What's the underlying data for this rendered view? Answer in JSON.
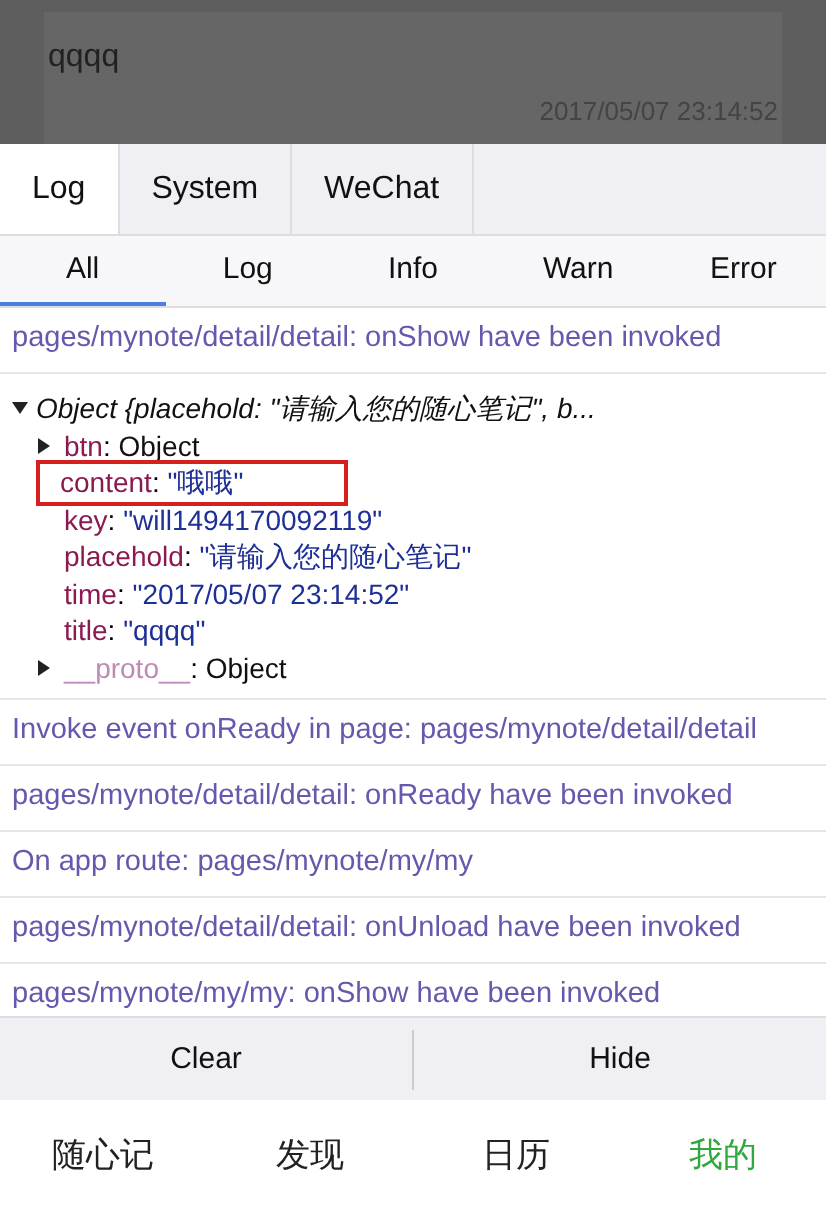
{
  "note_card": {
    "title": "qqqq",
    "time": "2017/05/07 23:14:52"
  },
  "tabs": [
    {
      "label": "Log",
      "selected": true
    },
    {
      "label": "System",
      "selected": false
    },
    {
      "label": "WeChat",
      "selected": false
    }
  ],
  "filters": [
    {
      "label": "All",
      "selected": true
    },
    {
      "label": "Log",
      "selected": false
    },
    {
      "label": "Info",
      "selected": false
    },
    {
      "label": "Warn",
      "selected": false
    },
    {
      "label": "Error",
      "selected": false
    }
  ],
  "log_entries": [
    {
      "kind": "text",
      "text": "pages/mynote/detail/detail: onShow have been invoked"
    },
    {
      "kind": "object",
      "summary": "Object {placehold: \"请输入您的随心笔记\", b...",
      "expanded": true,
      "properties": [
        {
          "key": "btn",
          "separator": ": ",
          "value": "Object",
          "kind": "object",
          "expanded": false,
          "highlighted": false
        },
        {
          "key": "content",
          "separator": ": ",
          "value": "\"哦哦\"",
          "kind": "string",
          "highlighted": true
        },
        {
          "key": "key",
          "separator": ": ",
          "value": "\"will1494170092119\"",
          "kind": "string",
          "highlighted": false
        },
        {
          "key": "placehold",
          "separator": ": ",
          "value": "\"请输入您的随心笔记\"",
          "kind": "string",
          "highlighted": false
        },
        {
          "key": "time",
          "separator": ": ",
          "value": "\"2017/05/07 23:14:52\"",
          "kind": "string",
          "highlighted": false
        },
        {
          "key": "title",
          "separator": ": ",
          "value": "\"qqqq\"",
          "kind": "string",
          "highlighted": false
        },
        {
          "key": "__proto__",
          "separator": ": ",
          "value": "Object",
          "kind": "proto",
          "expanded": false,
          "highlighted": false
        }
      ]
    },
    {
      "kind": "text",
      "text": "Invoke event onReady in page: pages/mynote/detail/detail"
    },
    {
      "kind": "text",
      "text": "pages/mynote/detail/detail: onReady have been invoked"
    },
    {
      "kind": "text",
      "text": "On app route: pages/mynote/my/my"
    },
    {
      "kind": "text",
      "text": "pages/mynote/detail/detail: onUnload have been invoked"
    },
    {
      "kind": "text",
      "text": "pages/mynote/my/my: onShow have been invoked"
    }
  ],
  "actions": [
    "Clear",
    "Hide"
  ],
  "nav": [
    {
      "label": "随心记",
      "selected": false
    },
    {
      "label": "发现",
      "selected": false
    },
    {
      "label": "日历",
      "selected": false
    },
    {
      "label": "我的",
      "selected": true
    }
  ]
}
